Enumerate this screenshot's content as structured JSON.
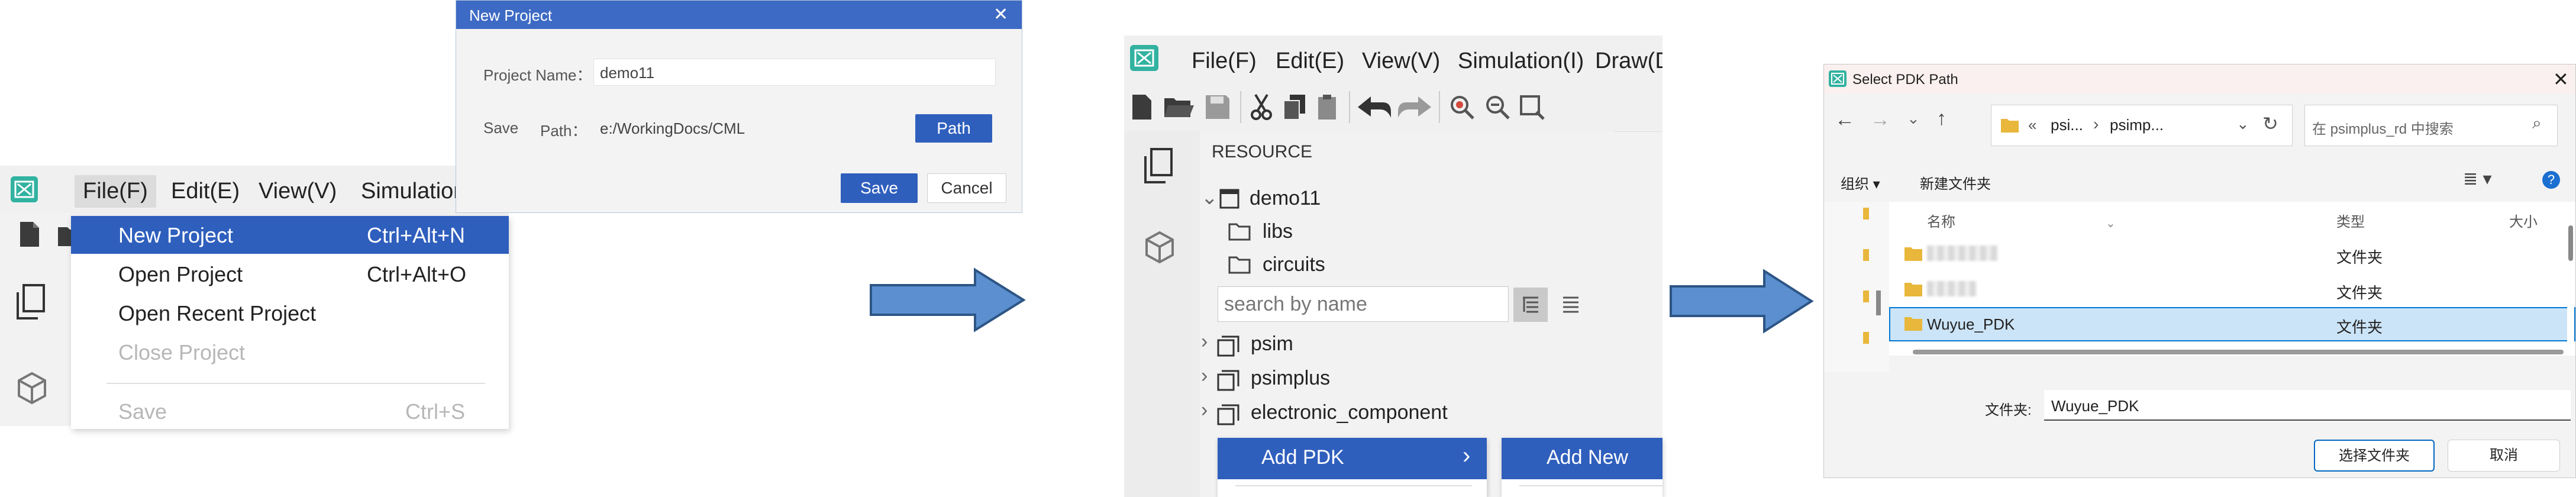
{
  "panel1": {
    "menubar": [
      "File(F)",
      "Edit(E)",
      "View(V)",
      "Simulation(I)"
    ],
    "file_menu": [
      {
        "label": "New Project",
        "shortcut": "Ctrl+Alt+N"
      },
      {
        "label": "Open Project",
        "shortcut": "Ctrl+Alt+O"
      },
      {
        "label": "Open Recent Project",
        "shortcut": ""
      },
      {
        "label": "Close Project",
        "shortcut": ""
      },
      {
        "label": "Save",
        "shortcut": "Ctrl+S"
      }
    ],
    "new_project_dialog": {
      "title": "New Project",
      "close": "✕",
      "project_name_label": "Project Name：",
      "project_name_value": "demo11",
      "save_label": "Save",
      "path_label": "Path：",
      "path_value": "e:/WorkingDocs/CML",
      "path_button": "Path",
      "save_button": "Save",
      "cancel_button": "Cancel"
    }
  },
  "panel2": {
    "menubar": [
      "File(F)",
      "Edit(E)",
      "View(V)",
      "Simulation(I)",
      "Draw(D"
    ],
    "tree": {
      "header": "RESOURCE",
      "project": "demo11",
      "children": [
        "libs",
        "circuits"
      ],
      "search_placeholder": "search by name",
      "libraries": [
        "psim",
        "psimplus",
        "electronic_component"
      ]
    },
    "context_menu": {
      "add_pdk": "Add PDK",
      "chevron": "›",
      "submenu_add_new": "Add New"
    }
  },
  "panel3": {
    "title": "Select PDK Path",
    "close": "✕",
    "breadcrumb": [
      "«",
      "psi...",
      "›",
      "psimp..."
    ],
    "search_placeholder": "在 psimplus_rd 中搜索",
    "cmd_organize": "组织 ▾",
    "cmd_new_folder": "新建文件夹",
    "help": "?",
    "columns": {
      "name": "名称",
      "type": "类型",
      "size": "大小"
    },
    "rows": [
      {
        "name": "",
        "type": "文件夹",
        "selected": false
      },
      {
        "name": "",
        "type": "文件夹",
        "selected": false
      },
      {
        "name": "Wuyue_PDK",
        "type": "文件夹",
        "selected": true
      }
    ],
    "folder_label": "文件夹:",
    "folder_value": "Wuyue_PDK",
    "select_button": "选择文件夹",
    "cancel_button": "取消"
  },
  "colors": {
    "accent_blue": "#2f5fbd",
    "arrow_blue": "#5b8fd0",
    "selection_blue": "#cce4f7"
  }
}
